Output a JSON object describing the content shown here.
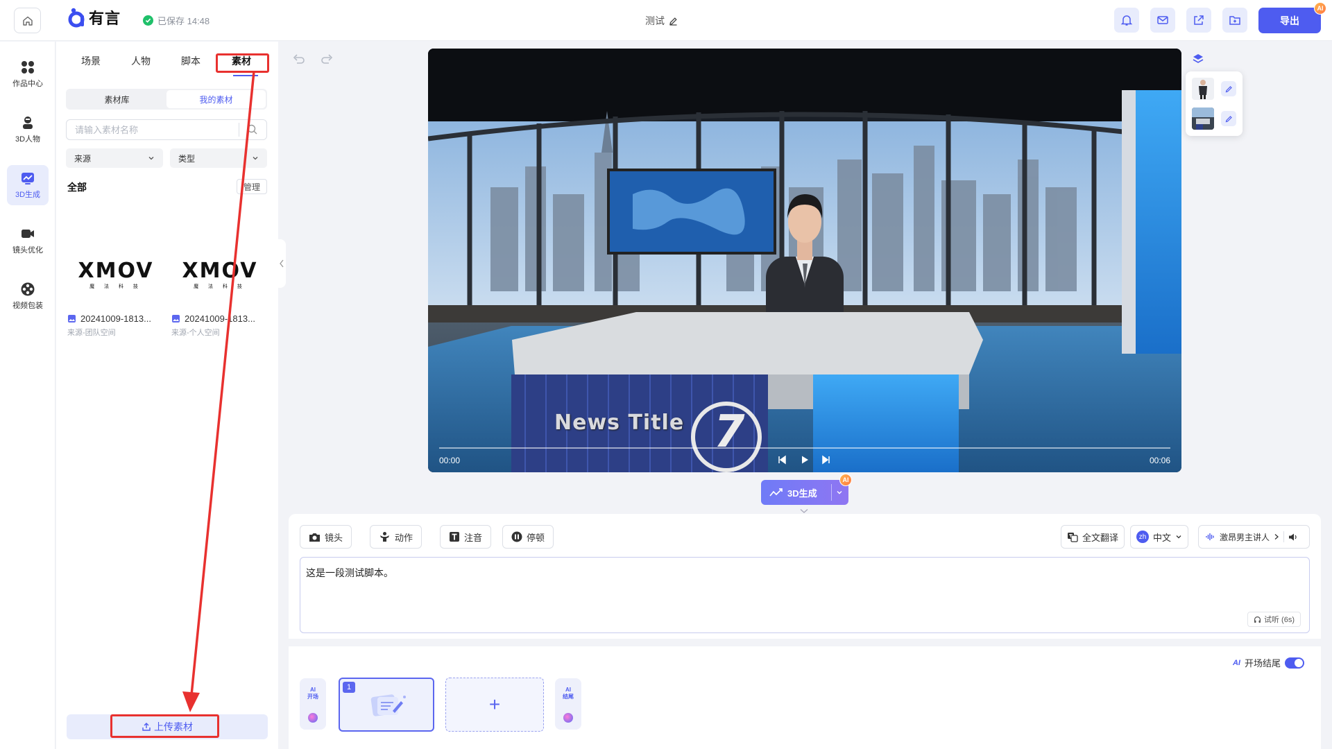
{
  "header": {
    "app_name": "有言",
    "saved_status": "已保存 14:48",
    "doc_title": "测试",
    "export_label": "导出",
    "ai_badge": "AI"
  },
  "nav": {
    "items": [
      {
        "label": "作品中心",
        "icon": "grid-icon"
      },
      {
        "label": "3D人物",
        "icon": "person-icon"
      },
      {
        "label": "3D生成",
        "icon": "chart-icon",
        "active": true
      },
      {
        "label": "镜头优化",
        "icon": "camera-icon"
      },
      {
        "label": "视频包装",
        "icon": "film-reel-icon"
      }
    ]
  },
  "panel": {
    "tabs": [
      "场景",
      "人物",
      "脚本",
      "素材"
    ],
    "active_tab": "素材",
    "segments": [
      "素材库",
      "我的素材"
    ],
    "active_segment": "我的素材",
    "search_placeholder": "请输入素材名称",
    "filters": [
      "来源",
      "类型"
    ],
    "section_label": "全部",
    "manage_label": "管理",
    "assets": [
      {
        "logo": "XMOV",
        "logo_sub": "魔 法 科 技",
        "name": "20241009-1813...",
        "source": "来源-团队空间"
      },
      {
        "logo": "XMOV",
        "logo_sub": "魔 法 科 技",
        "name": "20241009-1813...",
        "source": "来源-个人空间"
      }
    ],
    "upload_label": "上传素材"
  },
  "player": {
    "current_time": "00:00",
    "duration": "00:06",
    "progress": 0,
    "overlay_title": "News Title",
    "overlay_number": "7"
  },
  "generate": {
    "label": "3D生成",
    "ai_badge": "AI"
  },
  "editor": {
    "toolbar": [
      "镜头",
      "动作",
      "注音",
      "停顿"
    ],
    "translate_label": "全文翻译",
    "lang_code": "zh",
    "lang_label": "中文",
    "voice_label": "激昂男主讲人",
    "script_text": "这是一段测试脚本。",
    "listen_label": "试听 (6s)"
  },
  "timeline": {
    "toggle_label": "开场结尾",
    "toggle_on": true,
    "ai_label": "AI",
    "opening_label": "开场",
    "ending_label": "结尾",
    "shot_number": "1",
    "add_label": "+"
  },
  "colors": {
    "accent": "#4e5cf0",
    "annotation": "#e8312f",
    "saved": "#20c06a"
  }
}
